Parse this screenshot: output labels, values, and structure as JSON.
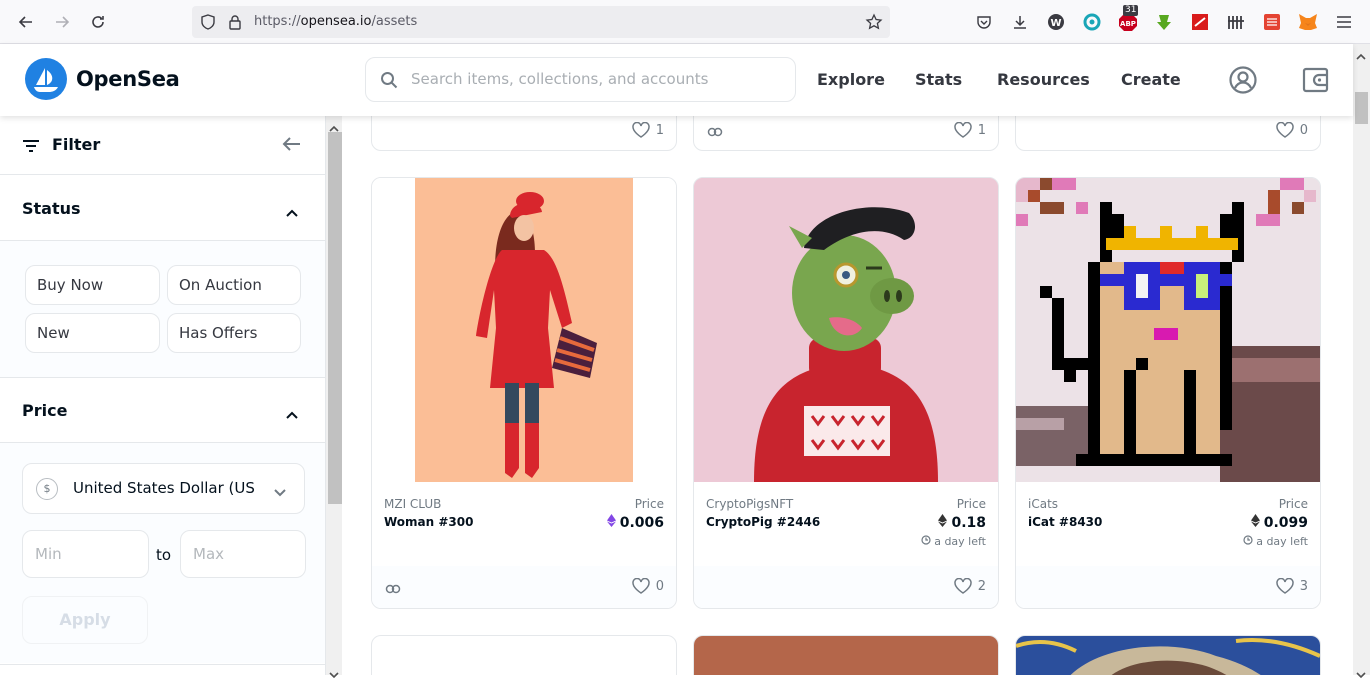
{
  "browser": {
    "url_prefix": "https://",
    "url_domain": "opensea.io",
    "url_path": "/assets",
    "badge_count": "31",
    "badge_text": "ABP"
  },
  "header": {
    "logo_text": "OpenSea",
    "search_placeholder": "Search items, collections, and accounts",
    "nav": [
      "Explore",
      "Stats",
      "Resources",
      "Create"
    ]
  },
  "sidebar": {
    "filter_label": "Filter",
    "status_title": "Status",
    "status_options": [
      "Buy Now",
      "On Auction",
      "New",
      "Has Offers"
    ],
    "price_title": "Price",
    "currency_symbol": "$",
    "currency": "United States Dollar (USD)",
    "min_placeholder": "Min",
    "to_label": "to",
    "max_placeholder": "Max",
    "apply_label": "Apply"
  },
  "top_row_likes": [
    "1",
    "1",
    "0"
  ],
  "cards": [
    {
      "collection": "MZI CLUB",
      "name": "Woman #300",
      "price_label": "Price",
      "price": "0.006",
      "time_left": "",
      "likes": "0"
    },
    {
      "collection": "CryptoPigsNFT",
      "name": "CryptoPig #2446",
      "price_label": "Price",
      "price": "0.18",
      "time_left": "a day left",
      "likes": "2"
    },
    {
      "collection": "iCats",
      "name": "iCat #8430",
      "price_label": "Price",
      "price": "0.099",
      "time_left": "a day left",
      "likes": "3"
    }
  ],
  "colors": {
    "brand": "#2081e2",
    "eth_purple": "#8247e5"
  }
}
